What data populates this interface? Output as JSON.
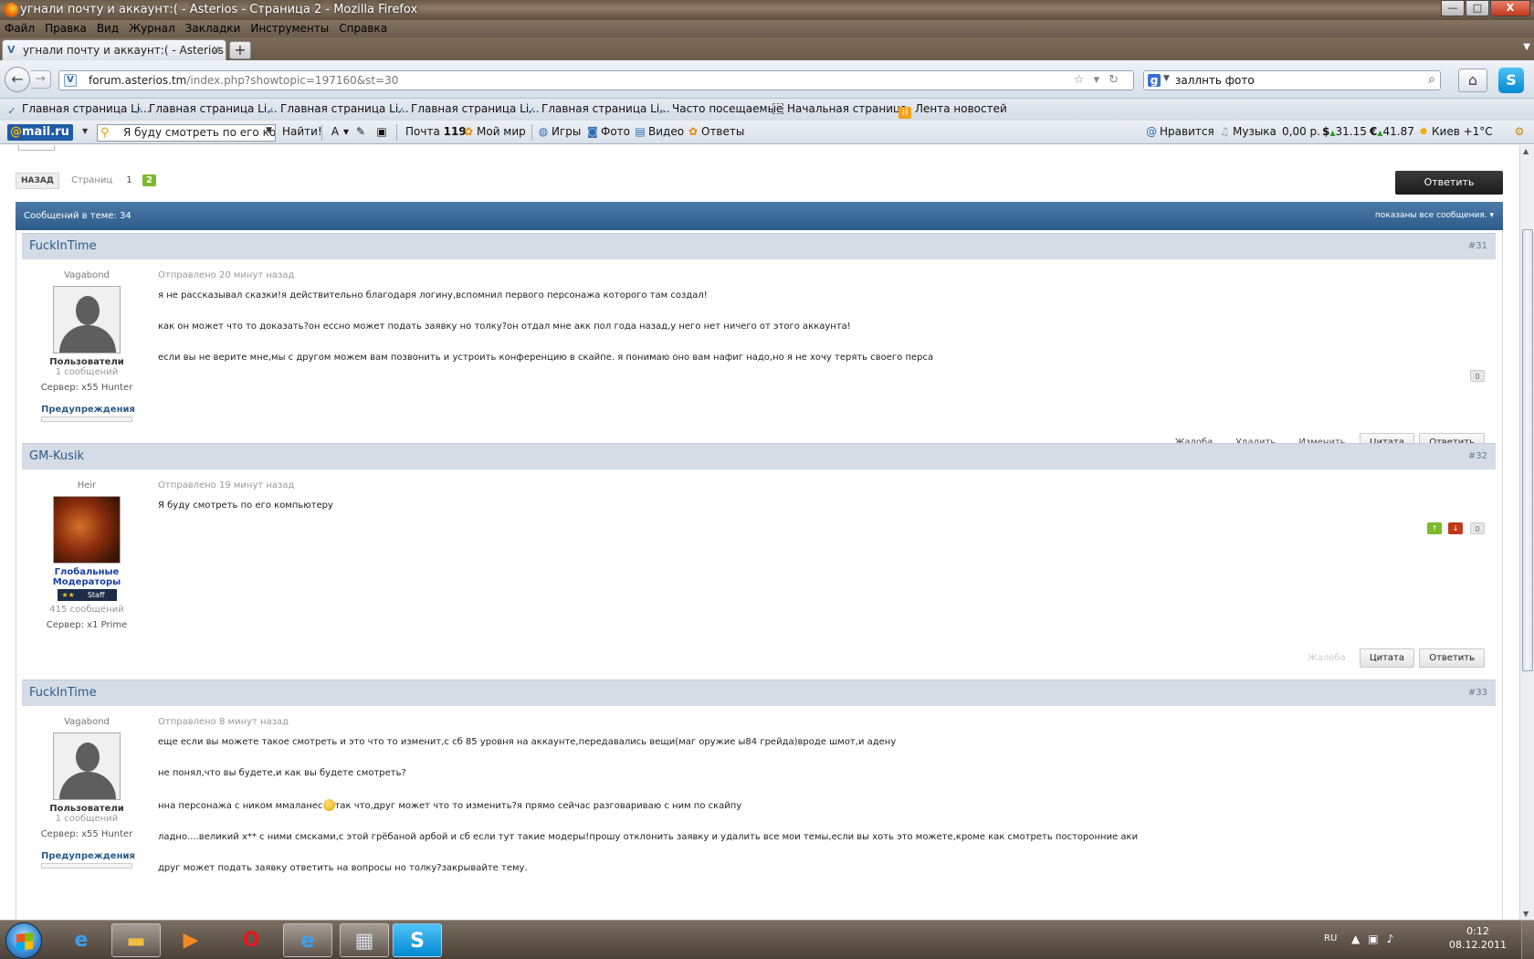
{
  "window": {
    "title": "угнали почту и аккаунт:( - Asterios - Страница 2 - Mozilla Firefox",
    "buttons": {
      "minimize": "—",
      "maximize": "□",
      "close": "X"
    }
  },
  "menu": [
    "Файл",
    "Правка",
    "Вид",
    "Журнал",
    "Закладки",
    "Инструменты",
    "Справка"
  ],
  "tab": {
    "label": "угнали почту и аккаунт:( - Asterios - Стр...",
    "close": "×",
    "new_tab": "+"
  },
  "nav": {
    "url_domain": "forum.asterios.tm",
    "url_path": "/index.php?showtopic=197160&st=30",
    "search_value": "заллнть фото",
    "search_engine": "g"
  },
  "bookmarks": [
    {
      "label": "Главная страница Li...",
      "icon": "bird-icon"
    },
    {
      "label": "Главная страница Li...",
      "icon": "bird-icon"
    },
    {
      "label": "Главная страница Li...",
      "icon": "bird-icon"
    },
    {
      "label": "Главная страница Li...",
      "icon": "bird-icon"
    },
    {
      "label": "Главная страница Li...",
      "icon": "bird-icon"
    },
    {
      "label": "Часто посещаемые",
      "icon": "magnifier-icon"
    },
    {
      "label": "Начальная страница",
      "icon": "page-icon"
    },
    {
      "label": "Лента новостей",
      "icon": "rss-icon"
    }
  ],
  "mailru": {
    "logo": "mail.ru",
    "search_value": "Я буду смотреть по его ком",
    "find_btn": "Найти!",
    "mail_label": "Почта",
    "mail_count": "119",
    "myworld": "Мой мир",
    "games": "Игры",
    "photo": "Фото",
    "video": "Видео",
    "answers": "Ответы",
    "like": "Нравится",
    "music": "Музыка",
    "balance": "0,00 р.",
    "usd": "31.15",
    "eur": "41.87",
    "weather": "Киев +1°С"
  },
  "forum": {
    "back": "НАЗАД",
    "pages_label": "Страниц",
    "page1": "1",
    "page2": "2",
    "reply_top": "Ответить",
    "topic_count": "Сообщений в теме: 34",
    "filter": "показаны все сообщения.",
    "posts": [
      {
        "author": "FuckInTime",
        "num": "#31",
        "title": "Vagabond",
        "group": "Пользователи",
        "count": "1 сообщений",
        "server": "Сервер: x55 Hunter",
        "warn": "Предупреждения",
        "date": "Отправлено 20 минут назад",
        "lines": [
          "я не рассказывал сказки!я действительно благодаря логину,вспомнил первого персонажа которого там создал!",
          "как он может что то доказать?он ессно может подать заявку но толку?он отдал мне акк пол года назад,у него нет ничего от этого аккаунта!",
          "если вы не верите мне,мы с другом можем вам позвонить и устроить конференцию в скайпе. я понимаю оно вам нафиг надо,но я не хочу терять своего перса"
        ],
        "rep": "0",
        "actions": [
          "Жалоба",
          "Удалить",
          "Изменить",
          "Цитата",
          "Ответить"
        ]
      },
      {
        "author": "GM-Kusik",
        "num": "#32",
        "title": "Heir",
        "group": "Глобальные Модераторы",
        "badge": "Staff",
        "badge_stars": "★★",
        "count": "415 сообщений",
        "server": "Сервер: x1 Prime",
        "date": "Отправлено 19 минут назад",
        "lines": [
          "Я буду смотреть по его компьютеру"
        ],
        "rep": "0",
        "rep_up": "↑",
        "rep_down": "↓",
        "actions": [
          "Жалоба",
          "Цитата",
          "Ответить"
        ]
      },
      {
        "author": "FuckInTime",
        "num": "#33",
        "title": "Vagabond",
        "group": "Пользователи",
        "count": "1 сообщений",
        "server": "Сервер: x55 Hunter",
        "warn": "Предупреждения",
        "date": "Отправлено 8 минут назад",
        "lines": [
          "еще если вы можете такое смотреть и это что то изменит,с сб 85 уровня на аккаунте,передавались вещи(маг оружие ы84 грейда)вроде шмот,и адену",
          "не понял,что вы будете,и как вы будете смотреть?",
          "нна персонажа с ником ммаланес",
          "так что,друг может что то изменить?я прямо сейчас разговариваю с ним по скайпу",
          "ладно....великий х** с ними смсками,с этой грёбаной арбой и сб если тут такие модеры!прошу отклонить заявку и удалить все мои темы,если вы хоть это можете,кроме как смотреть посторонние аки",
          "друг может подать заявку ответить на вопросы но толку?закрывайте тему."
        ]
      }
    ]
  },
  "taskbar": {
    "lang": "RU",
    "time": "0:12",
    "date": "08.12.2011"
  },
  "colors": {
    "topic_bar": "#2c5b8a",
    "post_head": "#d5dce6",
    "page_active": "#7cb92b",
    "rep_up": "#7cb92b",
    "rep_down": "#c0391b"
  }
}
